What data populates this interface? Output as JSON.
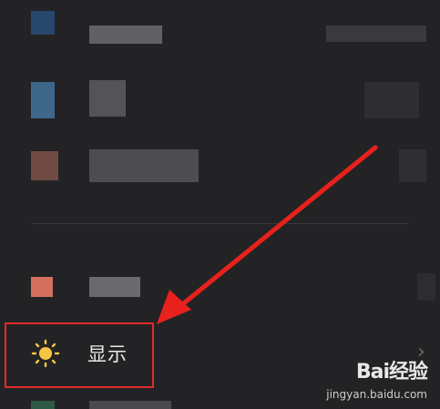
{
  "settings": {
    "items": [
      {
        "label": "显示",
        "icon": "sun-icon",
        "highlighted": true
      }
    ]
  },
  "watermark": {
    "brand": "Bai经验",
    "url": "jingyan.baidu.com"
  },
  "colors": {
    "background": "#232325",
    "highlight": "#e22a2a",
    "sun": "#f4c542",
    "arrow": "#e8211d"
  }
}
